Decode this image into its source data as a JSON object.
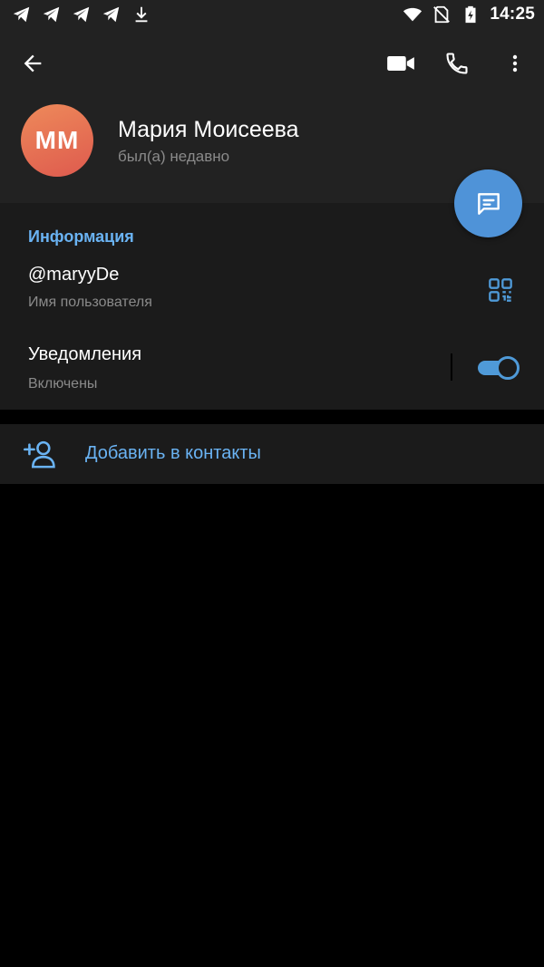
{
  "status_bar": {
    "time": "14:25",
    "icons": [
      "telegram-icon",
      "telegram-icon",
      "telegram-icon",
      "telegram-icon",
      "download-icon",
      "wifi-icon",
      "no-sim-icon",
      "battery-charging-icon"
    ]
  },
  "header": {
    "back_icon": "arrow-back-icon",
    "video_icon": "video-call-icon",
    "call_icon": "phone-icon",
    "more_icon": "more-vert-icon"
  },
  "profile": {
    "initials": "MM",
    "name": "Мария Моисеева",
    "status": "был(а) недавно",
    "avatar_colors": [
      "#ee8a5a",
      "#de5a4e"
    ]
  },
  "fab": {
    "icon": "message-icon",
    "color": "#4f93d8"
  },
  "info": {
    "section_title": "Информация",
    "username": "@maryyDe",
    "username_label": "Имя пользователя",
    "qr_icon": "qr-code-icon",
    "notifications_title": "Уведомления",
    "notifications_status": "Включены",
    "notifications_enabled": true
  },
  "add_contact": {
    "icon": "add-person-icon",
    "label": "Добавить в контакты"
  },
  "colors": {
    "accent": "#6ab3f3",
    "toggle": "#4f9ad8",
    "header_bg": "#222222",
    "section_bg": "#1b1b1b",
    "background": "#000000"
  }
}
